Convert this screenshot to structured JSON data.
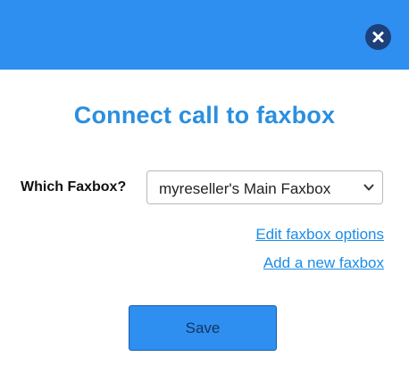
{
  "dialog": {
    "title": "Connect call to faxbox",
    "close_icon": "close-icon",
    "field_label": "Which Faxbox?",
    "select": {
      "selected_value": "myreseller's Main Faxbox"
    },
    "links": {
      "edit": "Edit faxbox options",
      "add": "Add a new faxbox"
    },
    "save_label": "Save"
  },
  "colors": {
    "header": "#2e8ff0",
    "title": "#2a8fe0",
    "link": "#1b8ce8",
    "close_button": "#1d3f7a",
    "save_button": "#2e8ff0"
  }
}
